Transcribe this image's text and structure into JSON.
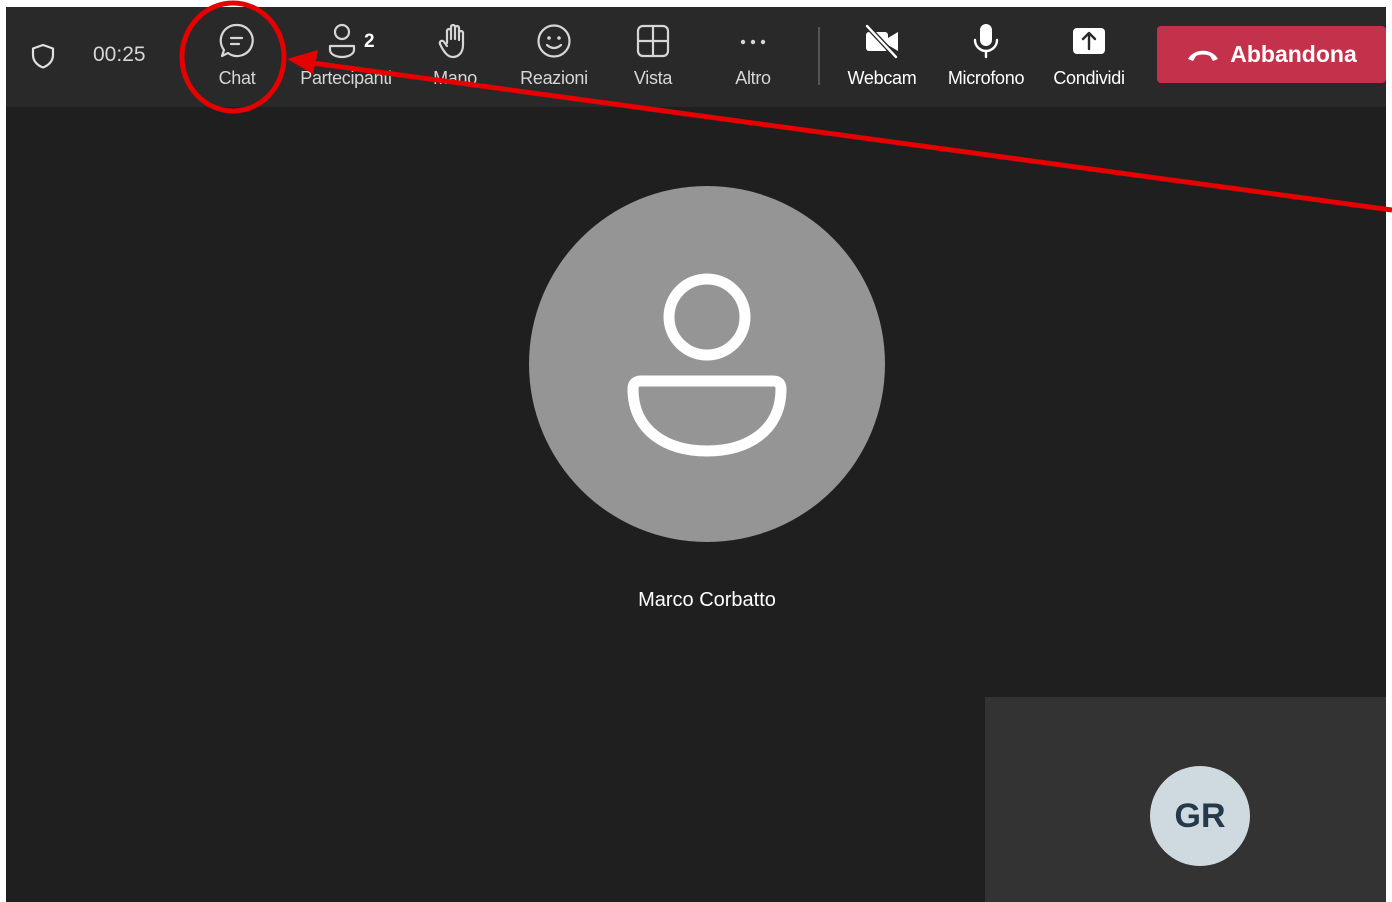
{
  "meeting": {
    "timer": "00:25"
  },
  "toolbar": {
    "chat_label": "Chat",
    "participants_label": "Partecipanti",
    "participants_count": "2",
    "raise_hand_label": "Mano",
    "reactions_label": "Reazioni",
    "view_label": "Vista",
    "more_label": "Altro",
    "webcam_label": "Webcam",
    "microphone_label": "Microfono",
    "share_label": "Condividi",
    "leave_label": "Abbandona"
  },
  "stage": {
    "main_participant_name": "Marco Corbatto",
    "self_initials": "GR"
  },
  "colors": {
    "leave_button": "#c4314b",
    "annotation": "#e60000",
    "background": "#1f1f1f",
    "toolbar": "#292929"
  },
  "icons": [
    "shield-icon",
    "chat-icon",
    "people-icon",
    "hand-icon",
    "smile-icon",
    "grid-icon",
    "more-icon",
    "webcam-off-icon",
    "microphone-icon",
    "share-icon",
    "hangup-icon",
    "person-icon"
  ]
}
